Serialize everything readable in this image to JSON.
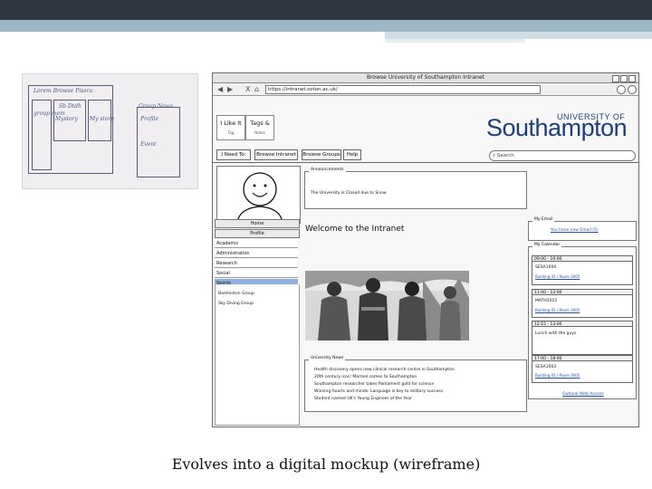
{
  "sketch": {
    "notes": [
      "Lorem Browse Pisera",
      "group mem",
      "Sb Dtdh",
      "Mystory",
      "My story",
      "Group News",
      "Profile",
      "Event"
    ]
  },
  "browser": {
    "window_title": "Browse University of Southampton Intranet",
    "close_symbol": "X",
    "url": "https://intranet.soton.ac.uk/"
  },
  "widgets": [
    {
      "title": "I Like It",
      "sub": "Tag"
    },
    {
      "title": "Tags &",
      "sub": "Notes"
    }
  ],
  "logo": {
    "line1": "UNIVERSITY OF",
    "line2": "Southampton"
  },
  "search": {
    "placeholder": "Search"
  },
  "menu": [
    "I Need To:",
    "Browse Intranet",
    "Browse Groups",
    "Help"
  ],
  "sidebar": {
    "home": "Home",
    "profile": "Profile",
    "items": [
      "Academic",
      "Administration",
      "Research",
      "Social",
      "Sports"
    ],
    "active": "Sports",
    "subitems": [
      "Badminton Group",
      "Sky Diving Group"
    ]
  },
  "announcements": {
    "legend": "Announcements",
    "text": "The University is Closed due to Snow"
  },
  "welcome": "Welcome to the Intranet",
  "news": {
    "legend": "University News",
    "items": [
      "Health discovery opens new clinical research centre in Southampton",
      "20th century icon' Marmel comes to Southampton",
      "Southampton researcher takes Parliament gold for science",
      "Winning hearts and minds: Language is key to military success",
      "Student named UK's Young Engineer of the Year"
    ]
  },
  "email": {
    "legend": "My Email",
    "link": "You have new Email (5)"
  },
  "calendar": {
    "legend": "My Calendar",
    "events": [
      {
        "time": "09:00 - 10:00",
        "title": "SESA1004",
        "link": "Building 35 / Room 3005"
      },
      {
        "time": "11:00 - 12:00",
        "title": "MATH1015",
        "link": "Building 45 / Room 3005"
      },
      {
        "time": "12:15 - 13:00",
        "title": "Lunch with the guys",
        "link": ""
      },
      {
        "time": "17:00 - 18:00",
        "title": "SESA1003",
        "link": "Building 45 / Room 3005"
      }
    ],
    "outlook": "Outlook Web Access"
  },
  "caption": "Evolves into a digital mockup (wireframe)"
}
